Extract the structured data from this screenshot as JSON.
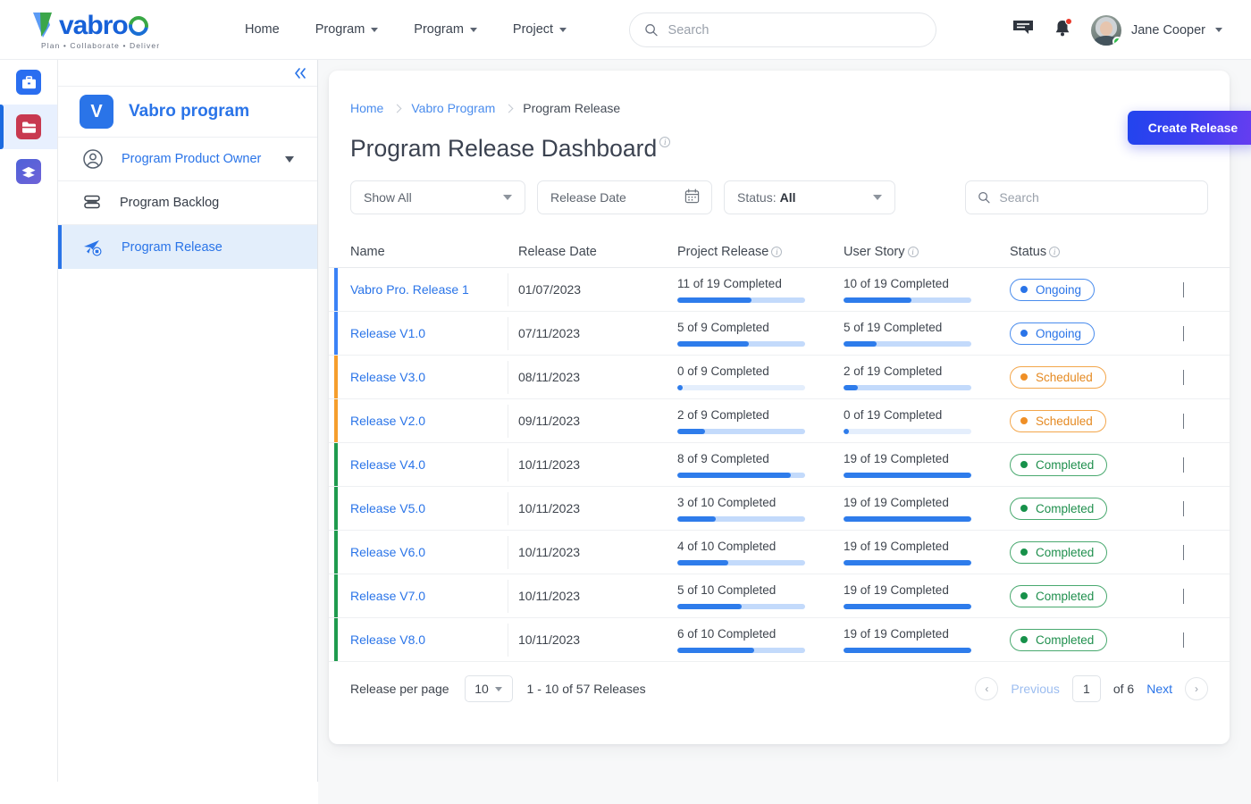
{
  "brand": {
    "name": "vabro",
    "tagline": "Plan • Collaborate • Deliver"
  },
  "header": {
    "nav": [
      {
        "label": "Home",
        "caret": false
      },
      {
        "label": "Program",
        "caret": true
      },
      {
        "label": "Program",
        "caret": true
      },
      {
        "label": "Project",
        "caret": true
      }
    ],
    "search_placeholder": "Search",
    "search_value": "",
    "search_icon": "search-icon",
    "note_icon": "note-icon",
    "bell_icon": "bell-icon",
    "user": "Jane Cooper"
  },
  "rail": [
    {
      "name": "briefcase",
      "glyph": "briefcase-icon",
      "color": "#2a6ef0",
      "active": false
    },
    {
      "name": "folder",
      "glyph": "folder-icon",
      "color": "#c8394f",
      "active": true
    },
    {
      "name": "layers",
      "glyph": "layers-icon",
      "color": "#4a5fd4",
      "active": false
    }
  ],
  "sidebar": {
    "collapse_icon": "collapse-left-icon",
    "program_initial": "V",
    "program_name": "Vabro program",
    "role": "Program Product Owner",
    "items": [
      {
        "label": "Program Backlog",
        "icon": "backlog-icon",
        "active": false
      },
      {
        "label": "Program Release",
        "icon": "release-rocket-icon",
        "active": true
      }
    ]
  },
  "main": {
    "breadcrumb": [
      {
        "label": "Home",
        "link": true
      },
      {
        "label": "Vabro Program",
        "link": true
      },
      {
        "label": "Program Release",
        "link": false
      }
    ],
    "create_button": "Create Release",
    "title": "Program Release Dashboard",
    "filters": {
      "show_all": "Show All",
      "release_date_placeholder": "Release Date",
      "status_label": "Status:",
      "status_value": "All",
      "search_placeholder": "Search",
      "search_value": ""
    },
    "table": {
      "columns": [
        {
          "label": "Name",
          "info": false
        },
        {
          "label": "Release Date",
          "info": false
        },
        {
          "label": "Project Release",
          "info": true
        },
        {
          "label": "User Story",
          "info": true
        },
        {
          "label": "Status",
          "info": true
        }
      ],
      "rows": [
        {
          "name": "Vabro Pro. Release 1",
          "date": "01/07/2023",
          "project": "11 of 19 Completed",
          "project_done": 11,
          "project_total": 19,
          "story": "10 of 19 Completed",
          "story_done": 10,
          "story_total": 19,
          "status": "Ongoing",
          "accent": "blue"
        },
        {
          "name": "Release V1.0",
          "date": "07/11/2023",
          "project": "5 of 9 Completed",
          "project_done": 5,
          "project_total": 9,
          "story": "5 of 19 Completed",
          "story_done": 5,
          "story_total": 19,
          "status": "Ongoing",
          "accent": "blue"
        },
        {
          "name": "Release V3.0",
          "date": "08/11/2023",
          "project": "0 of 9 Completed",
          "project_done": 0,
          "project_total": 9,
          "story": "2 of 19 Completed",
          "story_done": 2,
          "story_total": 19,
          "status": "Scheduled",
          "accent": "orange"
        },
        {
          "name": "Release V2.0",
          "date": "09/11/2023",
          "project": "2 of 9 Completed",
          "project_done": 2,
          "project_total": 9,
          "story": "0 of 19 Completed",
          "story_done": 0,
          "story_total": 19,
          "status": "Scheduled",
          "accent": "orange"
        },
        {
          "name": "Release V4.0",
          "date": "10/11/2023",
          "project": "8 of 9 Completed",
          "project_done": 8,
          "project_total": 9,
          "story": "19 of 19 Completed",
          "story_done": 19,
          "story_total": 19,
          "status": "Completed",
          "accent": "green"
        },
        {
          "name": "Release V5.0",
          "date": "10/11/2023",
          "project": "3 of 10 Completed",
          "project_done": 3,
          "project_total": 10,
          "story": "19 of 19 Completed",
          "story_done": 19,
          "story_total": 19,
          "status": "Completed",
          "accent": "green"
        },
        {
          "name": "Release V6.0",
          "date": "10/11/2023",
          "project": "4 of 10 Completed",
          "project_done": 4,
          "project_total": 10,
          "story": "19 of 19 Completed",
          "story_done": 19,
          "story_total": 19,
          "status": "Completed",
          "accent": "green"
        },
        {
          "name": "Release V7.0",
          "date": "10/11/2023",
          "project": "5 of 10 Completed",
          "project_done": 5,
          "project_total": 10,
          "story": "19 of 19 Completed",
          "story_done": 19,
          "story_total": 19,
          "status": "Completed",
          "accent": "green"
        },
        {
          "name": "Release V8.0",
          "date": "10/11/2023",
          "project": "6 of 10 Completed",
          "project_done": 6,
          "project_total": 10,
          "story": "19 of 19 Completed",
          "story_done": 19,
          "story_total": 19,
          "status": "Completed",
          "accent": "green"
        }
      ]
    },
    "footer": {
      "per_page_label": "Release per page",
      "per_page_value": "10",
      "range": "1 - 10 of 57 Releases",
      "previous": "Previous",
      "page_value": "1",
      "of_pages": "of 6",
      "next": "Next"
    }
  },
  "colors": {
    "accent_blue": "#2a74e8",
    "status_ongoing": "#2a74e8",
    "status_scheduled": "#ef8f26",
    "status_completed": "#17914a",
    "create_gradient_from": "#2244ee",
    "create_gradient_to": "#6a3df0"
  }
}
